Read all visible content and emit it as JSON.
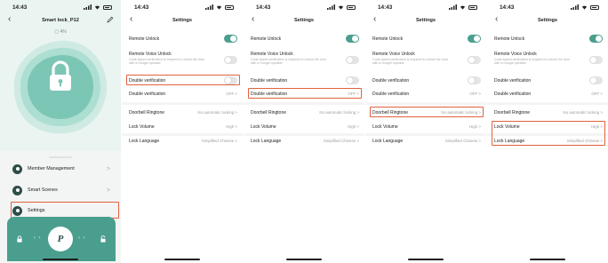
{
  "status_bar": {
    "time": "14:43"
  },
  "lock_home": {
    "title": "Smart lock_P12",
    "battery": "▢ 4%",
    "menu": [
      {
        "label": "Member Management",
        "icon": "user-icon"
      },
      {
        "label": "Smart Scenes",
        "icon": "scenes-icon"
      },
      {
        "label": "Settings",
        "icon": "settings-icon"
      }
    ],
    "unlock_button": "P"
  },
  "settings": {
    "title": "Settings",
    "rows": {
      "remote_unlock": "Remote Unlock",
      "remote_voice_unlock": "Remote Voice Unlock",
      "remote_voice_desc": "Code-based verification is required to unlock the door with a Google speaker.",
      "double_verification": "Double verification",
      "double_verification_value": "OFF",
      "doorbell_ringtone": "Doorbell Ringtone",
      "doorbell_ringtone_value": "No automatic locking",
      "lock_volume": "Lock Volume",
      "lock_volume_value": "High",
      "lock_language": "Lock Language",
      "lock_language_value": "Simplified Chinese"
    },
    "chevron": ">"
  },
  "colors": {
    "accent": "#4a9e8e",
    "highlight": "#e0623e",
    "home_bg": "#eaf4f1"
  }
}
